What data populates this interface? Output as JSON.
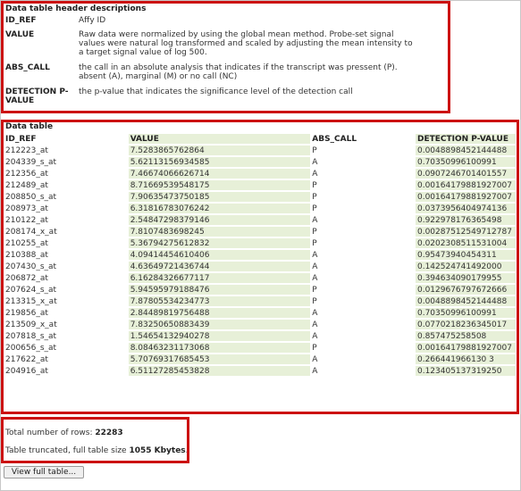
{
  "header_descriptions": {
    "title": "Data table header descriptions",
    "rows": [
      {
        "key": "ID_REF",
        "value": "Affy ID"
      },
      {
        "key": "VALUE",
        "value": "Raw data were normalized by using the global mean method. Probe-set signal values were natural log transformed and scaled by adjusting the mean intensity to a target signal value of log 500."
      },
      {
        "key": "ABS_CALL",
        "value": "the call in an absolute analysis that indicates if the transcript was pressent (P). absent (A), marginal (M) or no call (NC)"
      },
      {
        "key": "DETECTION P-VALUE",
        "value": "the p-value that indicates the significance level of the detection call"
      }
    ]
  },
  "data_table": {
    "title": "Data table",
    "columns": [
      "ID_REF",
      "VALUE",
      "ABS_CALL",
      "DETECTION P-VALUE"
    ],
    "rows": [
      [
        "212223_at",
        "7.5283865762864",
        "P",
        "0.0048898452144488"
      ],
      [
        "204339_s_at",
        "5.62113156934585",
        "A",
        "0.70350996100991"
      ],
      [
        "212356_at",
        "7.46674066626714",
        "A",
        "0.0907246701401557"
      ],
      [
        "212489_at",
        "8.71669539548175",
        "P",
        "0.00164179881927007"
      ],
      [
        "208850_s_at",
        "7.90635473750185",
        "P",
        "0.00164179881927007"
      ],
      [
        "208973_at",
        "6.31816783076242",
        "P",
        "0.0373956404974136"
      ],
      [
        "210122_at",
        "2.54847298379146",
        "A",
        "0.922978176365498"
      ],
      [
        "208174_x_at",
        "7.8107483698245",
        "P",
        "0.00287512549712787"
      ],
      [
        "210255_at",
        "5.36794275612832",
        "P",
        "0.0202308511531004"
      ],
      [
        "210388_at",
        "4.09414454610406",
        "A",
        "0.95473940454311"
      ],
      [
        "207430_s_at",
        "4.63649721436744",
        "A",
        "0.142524741492000"
      ],
      [
        "206872_at",
        "6.16284326677117",
        "A",
        "0.394634090179955"
      ],
      [
        "207624_s_at",
        "5.94595979188476",
        "P",
        "0.0129676797672666"
      ],
      [
        "213315_x_at",
        "7.87805534234773",
        "P",
        "0.0048898452144488"
      ],
      [
        "219856_at",
        "2.84489819756488",
        "A",
        "0.70350996100991"
      ],
      [
        "213509_x_at",
        "7.83250650883439",
        "A",
        "0.0770218236345017"
      ],
      [
        "207818_s_at",
        "1.54654132940278",
        "A",
        "0.857475258508"
      ],
      [
        "200656_s_at",
        "8.08463231173068",
        "P",
        "0.00164179881927007"
      ],
      [
        "217622_at",
        "5.70769317685453",
        "A",
        "0.266441966130 3"
      ],
      [
        "204916_at",
        "6.51127285453828",
        "A",
        "0.123405137319250"
      ]
    ]
  },
  "footer": {
    "total_rows_label": "Total number of rows: ",
    "total_rows_value": "22283",
    "truncated_label": "Table truncated, full table size ",
    "truncated_value": "1055 Kbytes",
    "truncated_suffix": ".",
    "view_button": "View full table..."
  },
  "colors": {
    "highlight_border": "#cc1111",
    "column_shade": "#e7f0d8"
  }
}
